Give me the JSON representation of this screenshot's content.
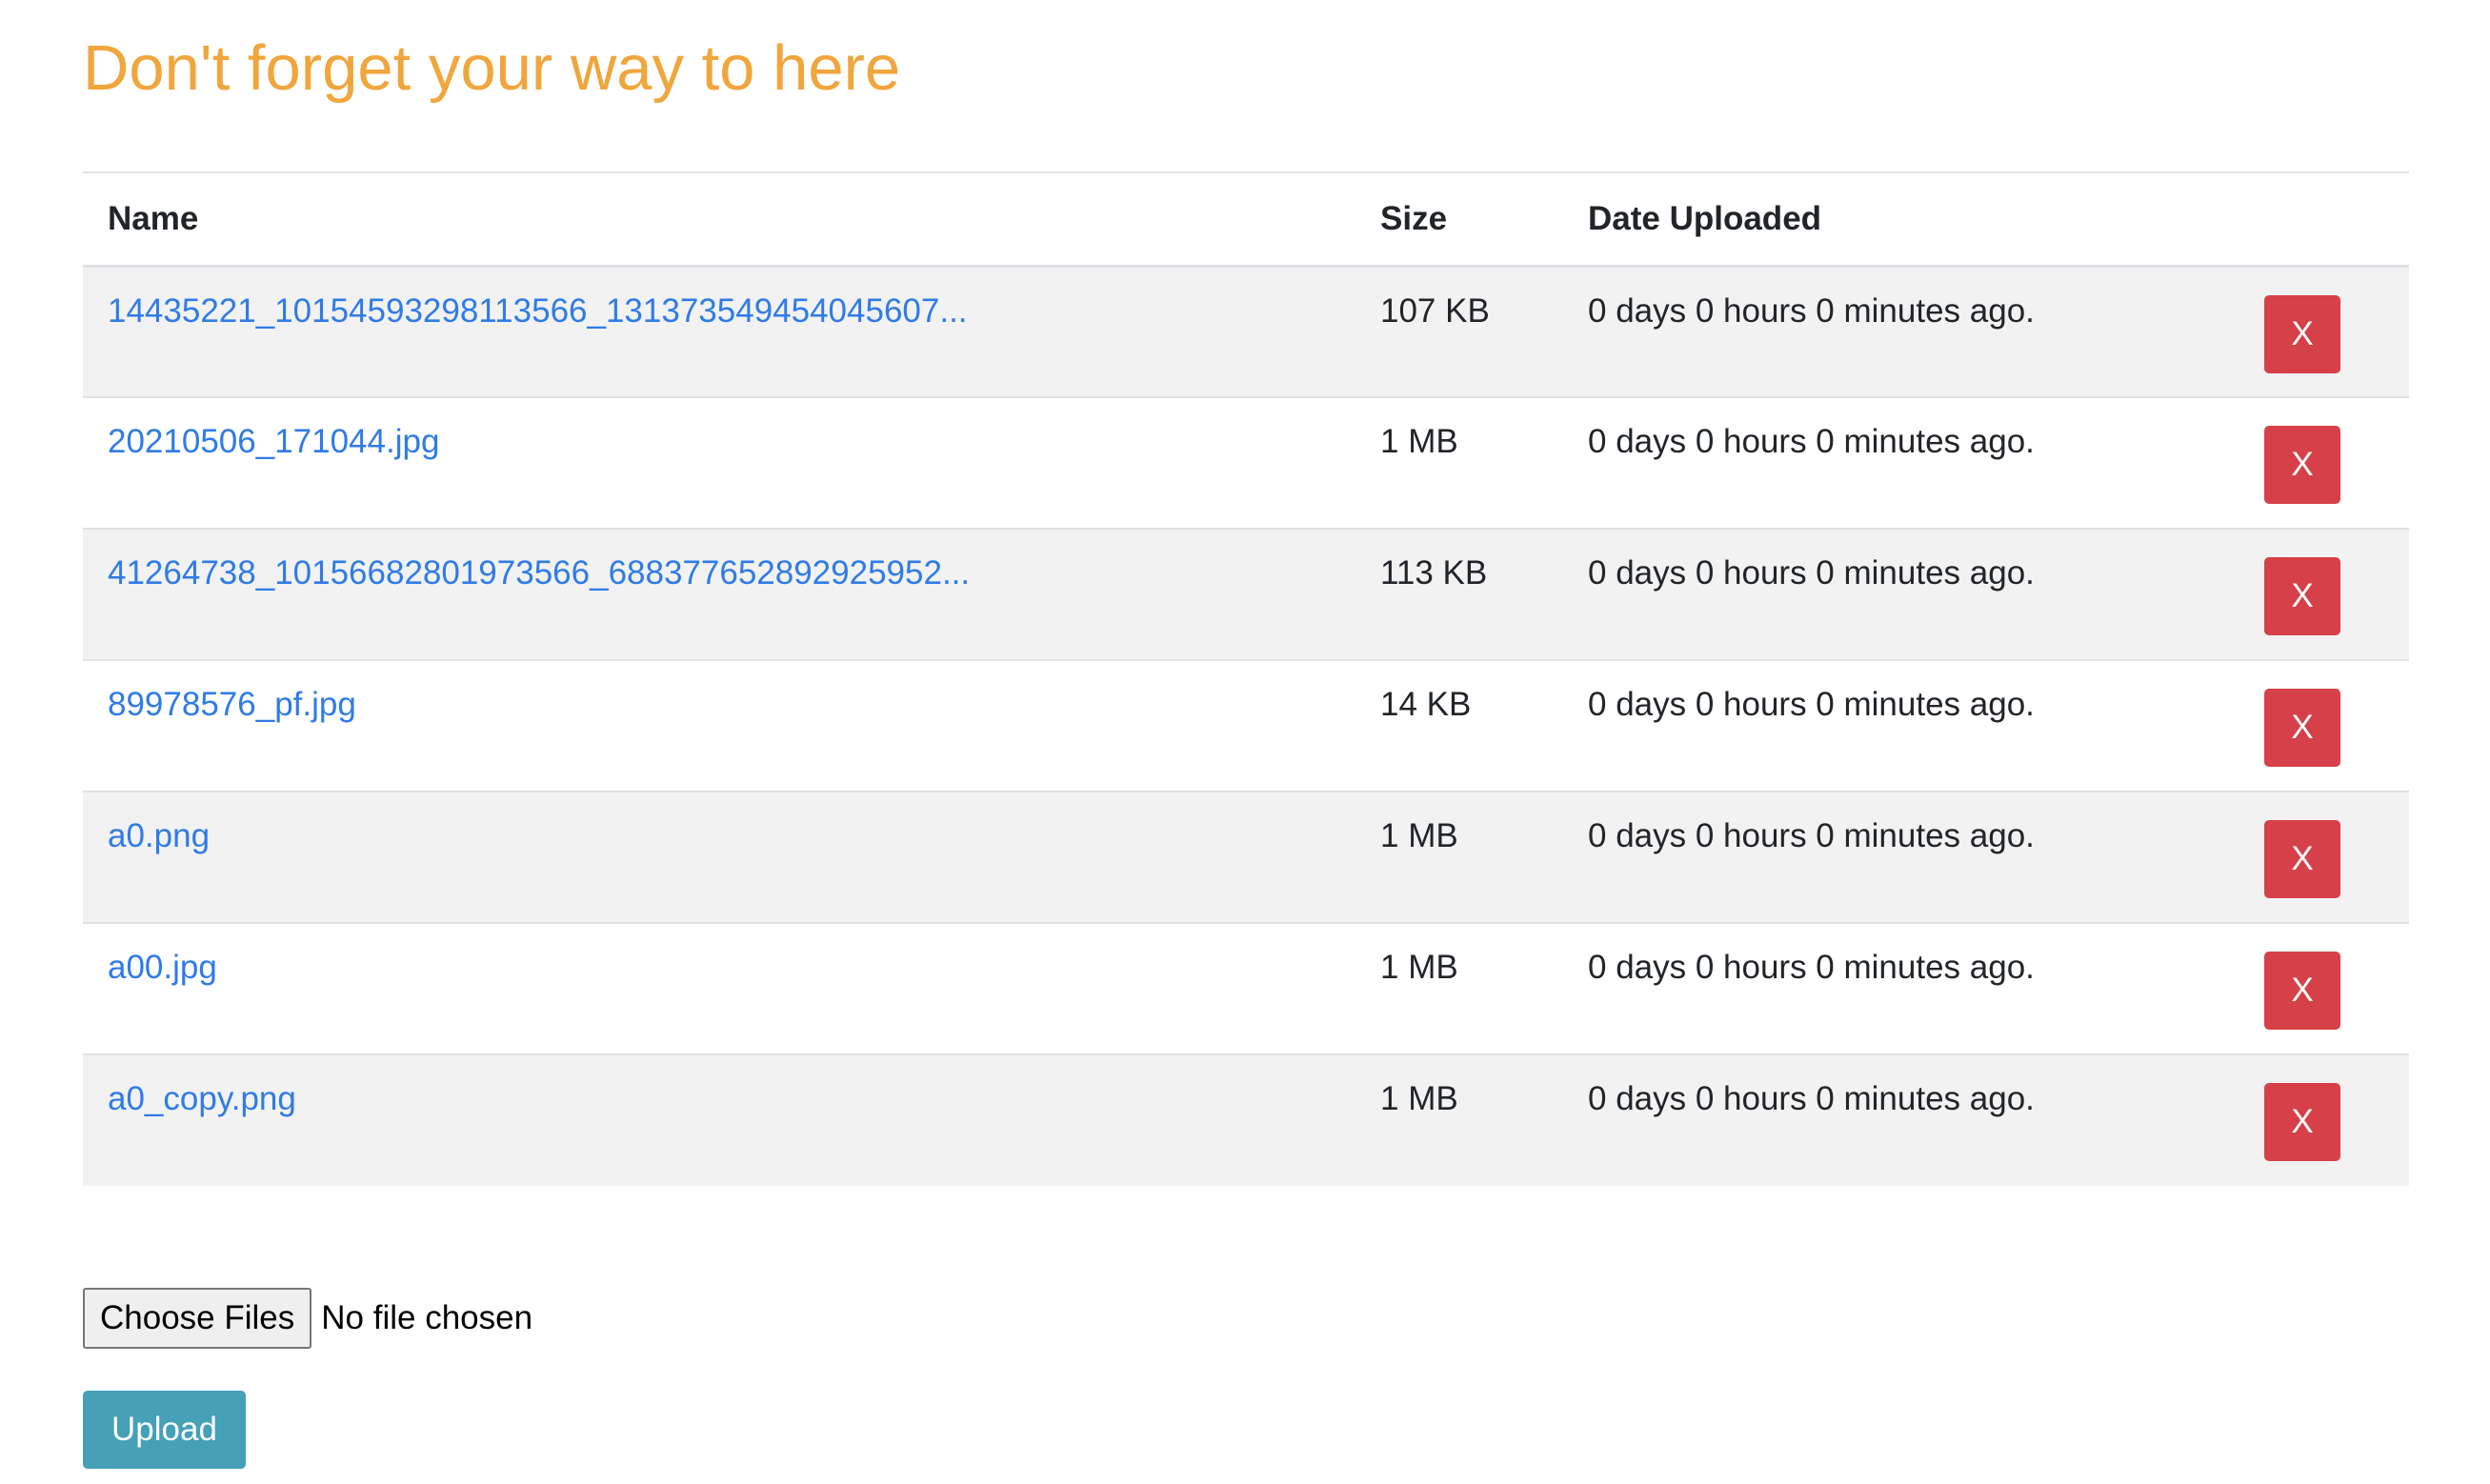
{
  "page": {
    "title": "Don't forget your way to here"
  },
  "table": {
    "headers": {
      "name": "Name",
      "size": "Size",
      "date": "Date Uploaded"
    },
    "rows": [
      {
        "name": "14435221_10154593298113566_131373549454045607...",
        "size": "107 KB",
        "date": "0 days 0 hours 0 minutes ago.",
        "delete_label": "X"
      },
      {
        "name": "20210506_171044.jpg",
        "size": "1 MB",
        "date": "0 days 0 hours 0 minutes ago.",
        "delete_label": "X"
      },
      {
        "name": "41264738_10156682801973566_688377652892925952...",
        "size": "113 KB",
        "date": "0 days 0 hours 0 minutes ago.",
        "delete_label": "X"
      },
      {
        "name": "89978576_pf.jpg",
        "size": "14 KB",
        "date": "0 days 0 hours 0 minutes ago.",
        "delete_label": "X"
      },
      {
        "name": "a0.png",
        "size": "1 MB",
        "date": "0 days 0 hours 0 minutes ago.",
        "delete_label": "X"
      },
      {
        "name": "a00.jpg",
        "size": "1 MB",
        "date": "0 days 0 hours 0 minutes ago.",
        "delete_label": "X"
      },
      {
        "name": "a0_copy.png",
        "size": "1 MB",
        "date": "0 days 0 hours 0 minutes ago.",
        "delete_label": "X"
      }
    ]
  },
  "upload": {
    "choose_label": "Choose Files",
    "status": "No file chosen",
    "upload_label": "Upload"
  },
  "colors": {
    "title": "#f0a63c",
    "link": "#2f7be8",
    "delete_button": "#d64048",
    "upload_button": "#45a0b8",
    "stripe": "#f2f2f2"
  }
}
